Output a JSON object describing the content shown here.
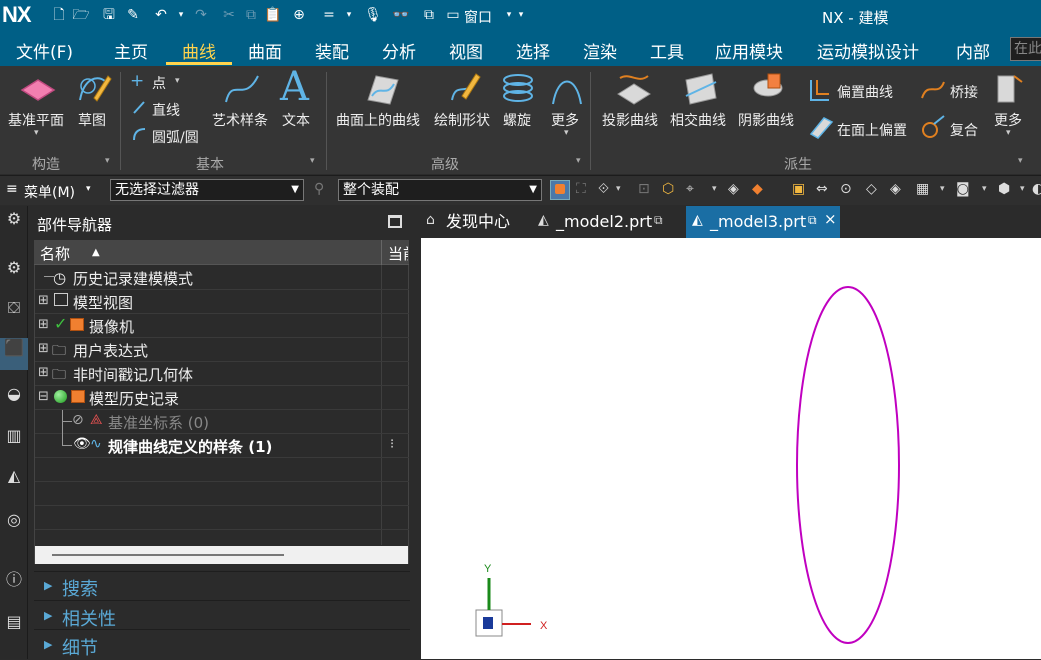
{
  "app": {
    "logo": "NX",
    "title": "NX - 建模"
  },
  "quick_access": {
    "window_label": "窗口"
  },
  "menubar": {
    "items": [
      "文件(F)",
      "主页",
      "曲线",
      "曲面",
      "装配",
      "分析",
      "视图",
      "选择",
      "渲染",
      "工具",
      "应用模块",
      "运动模拟设计",
      "内部"
    ],
    "active": "曲线",
    "search_placeholder": "在此"
  },
  "ribbon": {
    "groups": [
      {
        "name": "构造",
        "items": [
          "基准平面",
          "草图"
        ]
      },
      {
        "name": "基本",
        "items": [
          "点",
          "直线",
          "圆弧/圆",
          "艺术样条",
          "文本"
        ]
      },
      {
        "name": "高级",
        "items": [
          "曲面上的曲线",
          "绘制形状",
          "螺旋",
          "更多"
        ]
      },
      {
        "name": "派生",
        "items": [
          "投影曲线",
          "相交曲线",
          "阴影曲线",
          "偏置曲线",
          "在面上偏置",
          "桥接",
          "复合",
          "更多"
        ]
      }
    ]
  },
  "toolbar": {
    "menu_label": "菜单(M)",
    "filter_value": "无选择过滤器",
    "assembly_value": "整个装配"
  },
  "navigator": {
    "title": "部件导航器",
    "columns": [
      "名称",
      "当前"
    ],
    "rows": [
      {
        "label": "历史记录建模模式",
        "indent": 0
      },
      {
        "label": "模型视图",
        "indent": 0
      },
      {
        "label": "摄像机",
        "indent": 0
      },
      {
        "label": "用户表达式",
        "indent": 0
      },
      {
        "label": "非时间戳记几何体",
        "indent": 0
      },
      {
        "label": "模型历史记录",
        "indent": 0
      },
      {
        "label": "基准坐标系 (0)",
        "indent": 1
      },
      {
        "label": "规律曲线定义的样条 (1)",
        "indent": 1
      }
    ],
    "sections": [
      "搜索",
      "相关性",
      "细节"
    ]
  },
  "tabs": [
    {
      "label": "发现中心"
    },
    {
      "label": "_model2.prt"
    },
    {
      "label": "_model3.prt",
      "active": true
    }
  ],
  "viewport": {
    "curve_color": "#c000c0",
    "axis_x_label": "X",
    "axis_y_label": "Y",
    "axis_x_color": "#d02020",
    "axis_y_color": "#1a8a1a"
  }
}
